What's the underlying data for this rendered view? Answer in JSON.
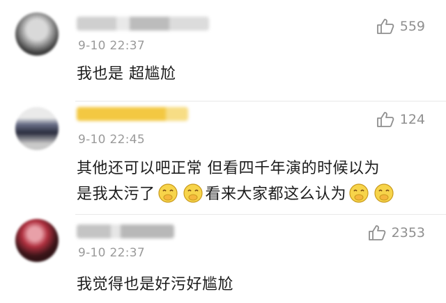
{
  "comments": [
    {
      "time": "9-10 22:37",
      "likes": "559",
      "text": "我也是 超尴尬"
    },
    {
      "time": "9-10 22:45",
      "likes": "124",
      "text_line1": "其他还可以吧正常 但看四千年演的时候以为",
      "text_line2_a": "是我太污了",
      "text_line2_b": "看来大家都这么认为"
    },
    {
      "time": "9-10 22:37",
      "likes": "2353",
      "text": "我觉得也是好污好尴尬"
    }
  ],
  "icons": {
    "like": "thumbs-up-icon",
    "emoji": "laughing-covering-mouth-emoji"
  },
  "colors": {
    "text": "#1c1c1c",
    "meta": "#9a9a9a",
    "username_highlight": "#f3c842"
  }
}
